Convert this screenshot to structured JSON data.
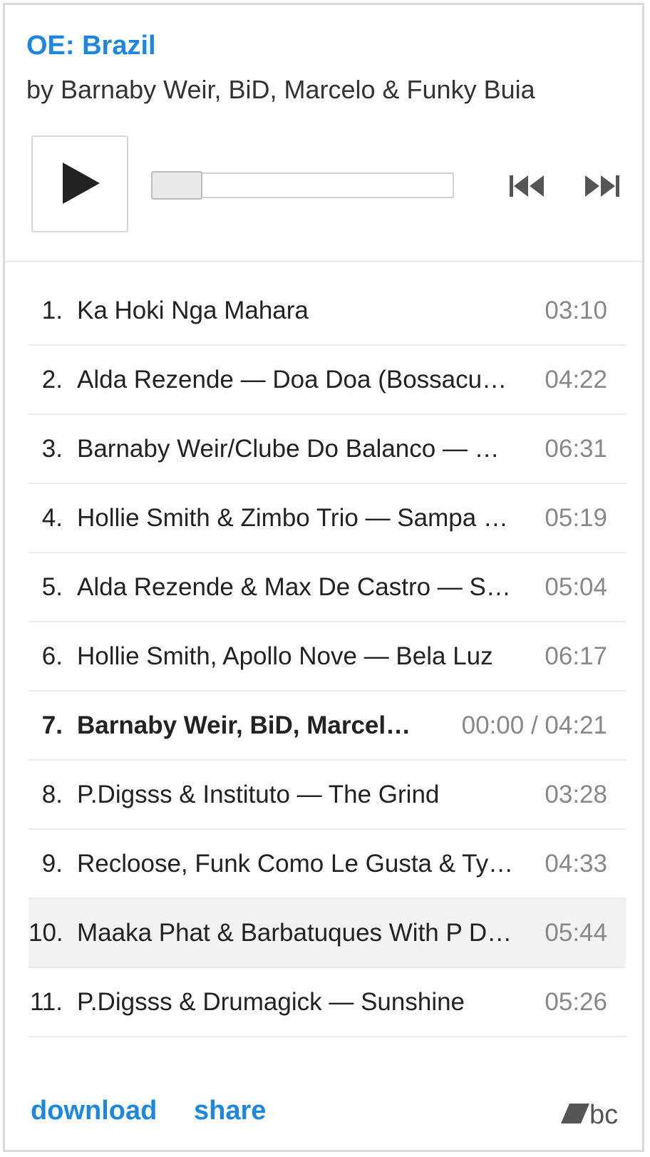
{
  "album": {
    "title": "OE: Brazil",
    "artist": "by Barnaby Weir, BiD, Marcelo & Funky Buia"
  },
  "player": {
    "play_icon": "play-icon",
    "prev_icon": "skip-previous-icon",
    "next_icon": "skip-next-icon",
    "progress": 0.0
  },
  "tracks": [
    {
      "num": "1.",
      "title": "Ka Hoki Nga Mahara",
      "time": "03:10"
    },
    {
      "num": "2.",
      "title": "Alda Rezende — Doa Doa (Bossacu…",
      "time": "04:22"
    },
    {
      "num": "3.",
      "title": "Barnaby Weir/Clube Do Balanco — …",
      "time": "06:31"
    },
    {
      "num": "4.",
      "title": "Hollie Smith & Zimbo Trio — Sampa …",
      "time": "05:19"
    },
    {
      "num": "5.",
      "title": "Alda Rezende & Max De Castro — S…",
      "time": "05:04"
    },
    {
      "num": "6.",
      "title": "Hollie Smith, Apollo Nove — Bela Luz",
      "time": "06:17"
    },
    {
      "num": "7.",
      "title": "Barnaby Weir, BiD, Marcel…",
      "time": "00:00 / 04:21",
      "current": true
    },
    {
      "num": "8.",
      "title": "P.Digsss & Instituto — The Grind",
      "time": "03:28"
    },
    {
      "num": "9.",
      "title": "Recloose, Funk Como Le Gusta & Ty…",
      "time": "04:33"
    },
    {
      "num": "10.",
      "title": "Maaka Phat & Barbatuques With P D…",
      "time": "05:44",
      "hovered": true
    },
    {
      "num": "11.",
      "title": "P.Digsss & Drumagick — Sunshine",
      "time": "05:26"
    }
  ],
  "footer": {
    "download_label": "download",
    "share_label": "share",
    "logo_icon": "bandcamp-logo-icon",
    "logo_text": "bc"
  },
  "colors": {
    "link": "#1d87e0",
    "time": "#888888",
    "hover_row": "#f2f2f2"
  }
}
